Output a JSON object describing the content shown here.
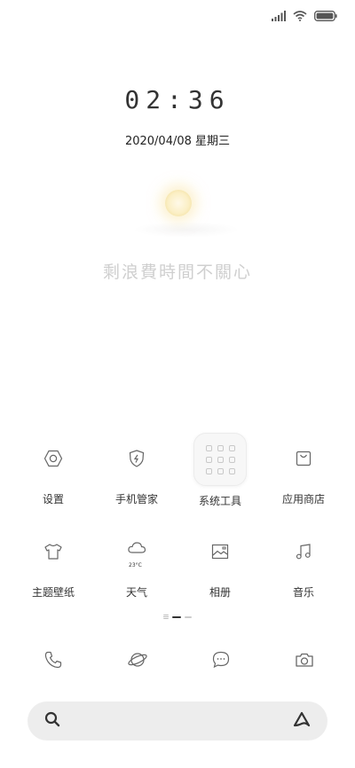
{
  "status_bar": {
    "signal_icon": "signal-icon",
    "wifi_icon": "wifi-icon",
    "battery_icon": "battery-icon"
  },
  "lock": {
    "time": "02:36",
    "date": "2020/04/08 星期三",
    "poem": "剩浪費時間不關心"
  },
  "apps": [
    {
      "label": "设置",
      "icon": "settings-icon"
    },
    {
      "label": "手机管家",
      "icon": "security-shield-icon"
    },
    {
      "label": "系统工具",
      "icon": "folder-icon"
    },
    {
      "label": "应用商店",
      "icon": "shopping-bag-icon"
    },
    {
      "label": "主题壁纸",
      "icon": "tshirt-icon"
    },
    {
      "label": "天气",
      "icon": "cloud-icon",
      "temp": "23°C"
    },
    {
      "label": "相册",
      "icon": "gallery-icon"
    },
    {
      "label": "音乐",
      "icon": "music-note-icon"
    }
  ],
  "dock": [
    {
      "icon": "phone-icon"
    },
    {
      "icon": "browser-planet-icon"
    },
    {
      "icon": "message-icon"
    },
    {
      "icon": "camera-icon"
    }
  ],
  "search": {
    "left_icon": "search-icon",
    "right_icon": "assistant-icon"
  }
}
